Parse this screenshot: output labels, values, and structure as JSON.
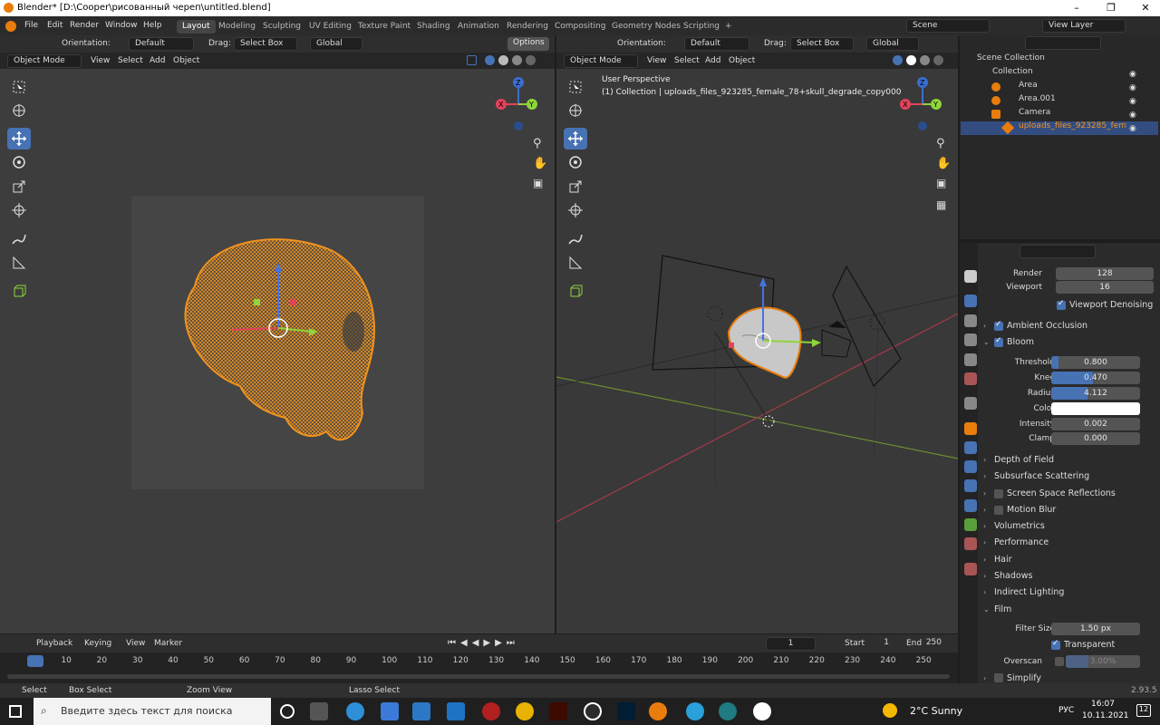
{
  "window": {
    "title": "Blender* [D:\\Cooper\\рисованный череп\\untitled.blend]",
    "minimize": "–",
    "maximize": "❐",
    "close": "✕"
  },
  "menu": [
    "File",
    "Edit",
    "Render",
    "Window",
    "Help"
  ],
  "workspaces": [
    "Layout",
    "Modeling",
    "Sculpting",
    "UV Editing",
    "Texture Paint",
    "Shading",
    "Animation",
    "Rendering",
    "Compositing",
    "Geometry Nodes",
    "Scripting",
    "+"
  ],
  "scene": {
    "name": "Scene",
    "view_layer": "View Layer"
  },
  "viewport_header": {
    "orientation_label": "Orientation:",
    "orientation_value": "Default",
    "drag_label": "Drag:",
    "drag_value": "Select Box",
    "transform": "Global",
    "options": "Options",
    "mode": "Object Mode",
    "view": "View",
    "select": "Select",
    "add": "Add",
    "object": "Object"
  },
  "right_viewport": {
    "perspective": "User Perspective",
    "collection_info": "(1) Collection | uploads_files_923285_female_78+skull_degrade_copy000"
  },
  "outliner": {
    "root": "Scene Collection",
    "collection": "Collection",
    "items": [
      "Area",
      "Area.001",
      "Camera",
      "uploads_files_923285_fem"
    ]
  },
  "properties": {
    "render_label": "Render",
    "render_value": "128",
    "viewport_label": "Viewport",
    "viewport_value": "16",
    "denoise_label": "Viewport Denoising",
    "ambient_occlusion": "Ambient Occlusion",
    "bloom": "Bloom",
    "bloom_fields": [
      {
        "label": "Threshold",
        "value": "0.800",
        "fill": 0.08
      },
      {
        "label": "Knee",
        "value": "0.470",
        "fill": 0.47
      },
      {
        "label": "Radius",
        "value": "4.112",
        "fill": 0.41
      },
      {
        "label": "Color",
        "value": "",
        "fill": 0
      },
      {
        "label": "Intensity",
        "value": "0.002",
        "fill": 0
      },
      {
        "label": "Clamp",
        "value": "0.000",
        "fill": 0
      }
    ],
    "panels": [
      "Depth of Field",
      "Subsurface Scattering",
      "Screen Space Reflections",
      "Motion Blur",
      "Volumetrics",
      "Performance",
      "Hair",
      "Shadows",
      "Indirect Lighting",
      "Film"
    ],
    "filter_size_label": "Filter Size",
    "filter_size_value": "1.50 px",
    "transparent_label": "Transparent",
    "overscan_label": "Overscan",
    "overscan_value": "3.00%",
    "simplify": "Simplify"
  },
  "timeline": {
    "playback": "Playback",
    "keying": "Keying",
    "view": "View",
    "marker": "Marker",
    "current": "1",
    "start_label": "Start",
    "start": "1",
    "end_label": "End",
    "end": "250",
    "ticks": [
      "1",
      "10",
      "20",
      "30",
      "40",
      "50",
      "60",
      "70",
      "80",
      "90",
      "100",
      "110",
      "120",
      "130",
      "140",
      "150",
      "160",
      "170",
      "180",
      "190",
      "200",
      "210",
      "220",
      "230",
      "240",
      "250"
    ]
  },
  "status": {
    "select": "Select",
    "box_select": "Box Select",
    "zoom_view": "Zoom View",
    "lasso_select": "Lasso Select",
    "version": "2.93.5"
  },
  "taskbar": {
    "search_placeholder": "Введите здесь текст для поиска",
    "weather": "2°C  Sunny",
    "lang": "РУС",
    "time": "16:07",
    "date": "10.11.2021",
    "notif": "12"
  },
  "colors": {
    "accent": "#4772b3",
    "skull_wire": "#f0931e",
    "selected": "#e87d0d"
  }
}
